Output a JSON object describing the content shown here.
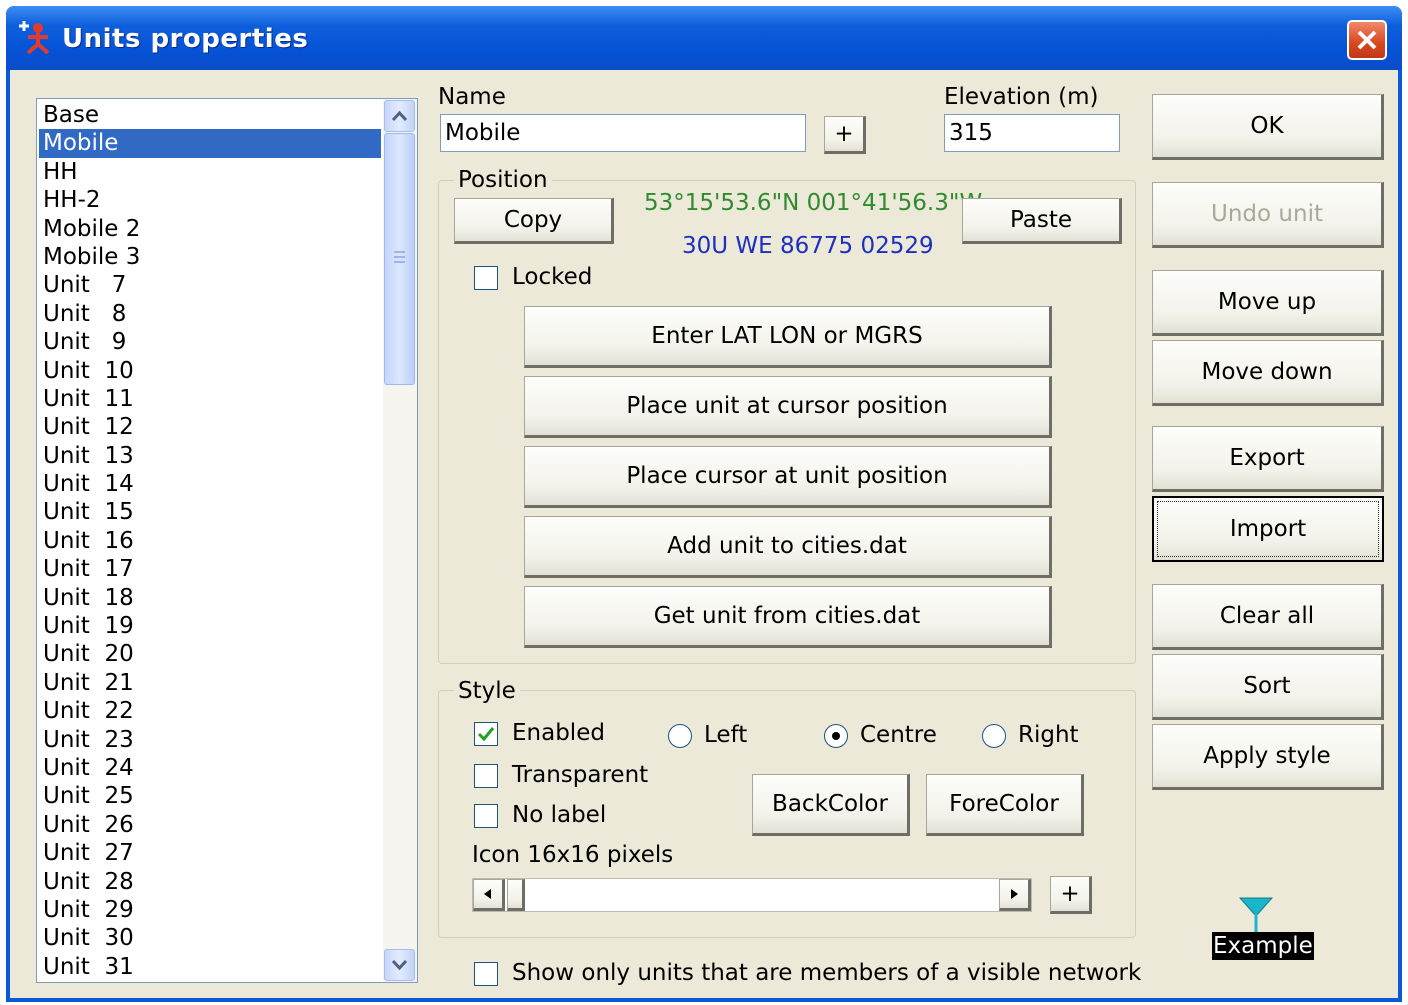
{
  "window": {
    "title": "Units properties",
    "close_label": "×"
  },
  "units_list": {
    "items": [
      "Base",
      "Mobile",
      "HH",
      "HH-2",
      "Mobile 2",
      "Mobile 3",
      "Unit   7",
      "Unit   8",
      "Unit   9",
      "Unit  10",
      "Unit  11",
      "Unit  12",
      "Unit  13",
      "Unit  14",
      "Unit  15",
      "Unit  16",
      "Unit  17",
      "Unit  18",
      "Unit  19",
      "Unit  20",
      "Unit  21",
      "Unit  22",
      "Unit  23",
      "Unit  24",
      "Unit  25",
      "Unit  26",
      "Unit  27",
      "Unit  28",
      "Unit  29",
      "Unit  30",
      "Unit  31"
    ],
    "selected": "Mobile"
  },
  "name_field": {
    "label": "Name",
    "value": "Mobile",
    "plus_label": "+"
  },
  "elevation_field": {
    "label": "Elevation (m)",
    "value": "315"
  },
  "position": {
    "group_label": "Position",
    "copy_label": "Copy",
    "paste_label": "Paste",
    "latlon": "53°15'53.6\"N 001°41'56.3\"W",
    "mgrs": "30U WE 86775 02529",
    "latlon_color": "#2e8b2e",
    "mgrs_color": "#1c2fbf",
    "locked_label": "Locked",
    "locked": false,
    "buttons": [
      "Enter LAT LON or MGRS",
      "Place unit at cursor position",
      "Place cursor at unit position",
      "Add unit to cities.dat",
      "Get unit from cities.dat"
    ]
  },
  "style": {
    "group_label": "Style",
    "enabled_label": "Enabled",
    "enabled": true,
    "transparent_label": "Transparent",
    "transparent": false,
    "nolabel_label": "No label",
    "nolabel": false,
    "align_left": "Left",
    "align_centre": "Centre",
    "align_right": "Right",
    "alignment": "Centre",
    "backcolor_label": "BackColor",
    "forecolor_label": "ForeColor",
    "icon_label": "Icon 16x16 pixels",
    "plus_label": "+"
  },
  "side_buttons": {
    "ok": "OK",
    "undo": "Undo unit",
    "move_up": "Move up",
    "move_down": "Move down",
    "export": "Export",
    "import": "Import",
    "clear_all": "Clear all",
    "sort": "Sort",
    "apply_style": "Apply style"
  },
  "example": {
    "label": "Example",
    "icon_color": "#19b6c8"
  },
  "show_only": {
    "label": "Show only units that are members of a visible network",
    "checked": false
  }
}
